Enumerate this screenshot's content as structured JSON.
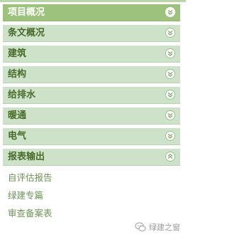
{
  "menu": {
    "items": [
      {
        "label": "项目概况",
        "expanded": false
      },
      {
        "label": "条文概况",
        "expanded": false
      },
      {
        "label": "建筑",
        "expanded": false
      },
      {
        "label": "结构",
        "expanded": false
      },
      {
        "label": "给排水",
        "expanded": false
      },
      {
        "label": "暖通",
        "expanded": false
      },
      {
        "label": "电气",
        "expanded": false
      },
      {
        "label": "报表输出",
        "expanded": true
      }
    ],
    "subitems": [
      {
        "label": "自评估报告"
      },
      {
        "label": "绿建专篇"
      },
      {
        "label": "审查备案表"
      }
    ]
  },
  "watermark": {
    "label": "绿建之窗",
    "icon": "wechat-icon"
  },
  "colors": {
    "active_header": "#9dc27d",
    "header": "#cde2c8",
    "text": "#486b2a",
    "subtext": "#6d9356"
  }
}
